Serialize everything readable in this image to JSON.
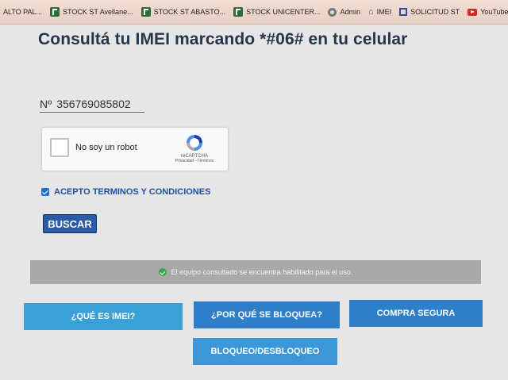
{
  "bookmarks": [
    {
      "label": "ALTO PAL...",
      "icon": "none"
    },
    {
      "label": "STOCK ST Avellane...",
      "icon": "green-tile-icon"
    },
    {
      "label": "STOCK ST ABASTO...",
      "icon": "green-tile-icon"
    },
    {
      "label": "STOCK UNICENTER...",
      "icon": "green-tile-icon"
    },
    {
      "label": "Admin",
      "icon": "globe-icon"
    },
    {
      "label": "IMEI",
      "icon": "house-icon"
    },
    {
      "label": "SOLICITUD ST",
      "icon": "blue-square-icon"
    },
    {
      "label": "YouTube",
      "icon": "youtube-icon"
    }
  ],
  "main": {
    "title": "Consultá tu IMEI marcando *#06# en tu celular",
    "imei_prefix": "Nº",
    "imei_value": "356769085802",
    "recaptcha": {
      "label": "No soy un robot",
      "brand": "reCAPTCHA",
      "links": "Privacidad - Términos"
    },
    "terms_label": "ACEPTO TERMINOS Y CONDICIONES",
    "search_button": "BUSCAR",
    "status_message": "El equipo consultado se encuentra habilitado para el uso.",
    "buttons": {
      "what_is_imei": "¿QUÉ ES IMEI?",
      "why_blocked": "¿POR QUÉ SE BLOQUEA?",
      "safe_purchase": "COMPRA SEGURA",
      "block_unblock": "BLOQUEO/DESBLOQUEO"
    }
  },
  "colors": {
    "title": "#26364a",
    "accent_blue": "#2f7fc8",
    "light_blue": "#3aa0d8",
    "status_bar": "#a9a9a9",
    "success_green": "#36a845"
  }
}
